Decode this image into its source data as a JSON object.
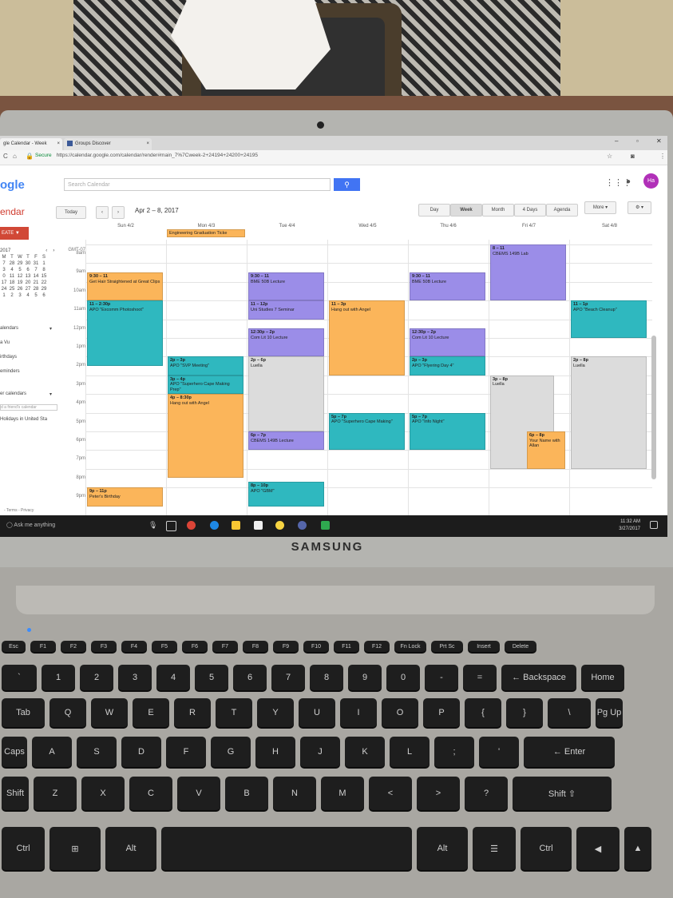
{
  "browser": {
    "tabs": [
      {
        "label": "gle Calendar - Week"
      },
      {
        "label": "Groups Discover"
      }
    ],
    "secure_label": "Secure",
    "url": "https://calendar.google.com/calendar/render#main_7%7Cweek-2+24194+24200+24195"
  },
  "gcal": {
    "logo": "ogle",
    "app_name": "endar",
    "search_placeholder": "Search Calendar",
    "avatar_initials": "Ha",
    "today_label": "Today",
    "date_range": "Apr 2 – 8, 2017",
    "views": [
      "Day",
      "Week",
      "Month",
      "4 Days",
      "Agenda"
    ],
    "more_label": "More ▾",
    "create_label": "EATE ▼",
    "timezone": "GMT-07"
  },
  "mini_calendar": {
    "month_label": "2017",
    "weekdays": [
      "M",
      "T",
      "W",
      "T",
      "F",
      "S"
    ],
    "rows": [
      [
        "7",
        "28",
        "29",
        "30",
        "31",
        "1"
      ],
      [
        "3",
        "4",
        "5",
        "6",
        "7",
        "8"
      ],
      [
        "0",
        "11",
        "12",
        "13",
        "14",
        "15"
      ],
      [
        "17",
        "18",
        "19",
        "20",
        "21",
        "22"
      ],
      [
        "24",
        "25",
        "26",
        "27",
        "28",
        "29"
      ],
      [
        "1",
        "2",
        "3",
        "4",
        "5",
        "6"
      ]
    ]
  },
  "sidebar": {
    "my_calendars": "alendars",
    "items": [
      "a Vu",
      "irthdays",
      "eminders"
    ],
    "other_calendars": "er calendars",
    "add_friend": "d a friend's calendar",
    "holidays": "Holidays in United Sta",
    "links": "- Terms - Privacy"
  },
  "week": {
    "days": [
      "Sun 4/2",
      "Mon 4/3",
      "Tue 4/4",
      "Wed 4/5",
      "Thu 4/6",
      "Fri 4/7",
      "Sat 4/8"
    ],
    "hours": [
      "8am",
      "9am",
      "10am",
      "11am",
      "12pm",
      "1pm",
      "2pm",
      "3pm",
      "4pm",
      "5pm",
      "6pm",
      "7pm",
      "8pm",
      "9pm"
    ],
    "all_day": [
      {
        "day": 1,
        "title": "Engineering Graduation Ticke"
      }
    ],
    "events": [
      {
        "day": 0,
        "start": 9.5,
        "end": 11,
        "time": "9:30 – 11",
        "title": "Get Hair Straightened at Great Clips",
        "color": "orange"
      },
      {
        "day": 0,
        "start": 11,
        "end": 14.5,
        "time": "11 – 2:30p",
        "title": "APO \"Excomm Photoshoot\"",
        "color": "teal"
      },
      {
        "day": 0,
        "start": 21,
        "end": 22,
        "time": "9p – 11p",
        "title": "Peter's Birthday",
        "color": "orange"
      },
      {
        "day": 1,
        "start": 14,
        "end": 15,
        "time": "2p – 3p",
        "title": "APO \"SVP Meeting\"",
        "color": "teal"
      },
      {
        "day": 1,
        "start": 15,
        "end": 16,
        "time": "3p – 4p",
        "title": "APO \"Superhero Cape Making Prep\"",
        "color": "teal"
      },
      {
        "day": 1,
        "start": 16,
        "end": 20.5,
        "time": "4p – 8:30p",
        "title": "Hang out with Angel",
        "color": "orange"
      },
      {
        "day": 2,
        "start": 9.5,
        "end": 11,
        "time": "9:30 – 11",
        "title": "BME 50B Lecture",
        "color": "purple"
      },
      {
        "day": 2,
        "start": 11,
        "end": 12,
        "time": "11 – 12p",
        "title": "Uni Studies 7 Seminar",
        "color": "purple"
      },
      {
        "day": 2,
        "start": 12.5,
        "end": 14,
        "time": "12:30p – 2p",
        "title": "Com Lit 10 Lecture",
        "color": "purple"
      },
      {
        "day": 2,
        "start": 14,
        "end": 18,
        "time": "2p – 6p",
        "title": "Luella",
        "color": "grey"
      },
      {
        "day": 2,
        "start": 18,
        "end": 19,
        "time": "6p – 7p",
        "title": "CBEMS 149B Lecture",
        "color": "purple"
      },
      {
        "day": 2,
        "start": 20.7,
        "end": 22,
        "time": "8p – 10p",
        "title": "APO \"GBM\"",
        "color": "teal"
      },
      {
        "day": 3,
        "start": 11,
        "end": 15,
        "time": "11 – 3p",
        "title": "Hang out with Angel",
        "color": "orange"
      },
      {
        "day": 3,
        "start": 17,
        "end": 19,
        "time": "5p – 7p",
        "title": "APO \"Superhero Cape Making\"",
        "color": "teal"
      },
      {
        "day": 4,
        "start": 9.5,
        "end": 11,
        "time": "9:30 – 11",
        "title": "BME 50B Lecture",
        "color": "purple"
      },
      {
        "day": 4,
        "start": 12.5,
        "end": 14,
        "time": "12:30p – 2p",
        "title": "Com Lit 10 Lecture",
        "color": "purple"
      },
      {
        "day": 4,
        "start": 14,
        "end": 15,
        "time": "2p – 3p",
        "title": "APO \"Flyering Day 4\"",
        "color": "teal"
      },
      {
        "day": 4,
        "start": 17,
        "end": 19,
        "time": "5p – 7p",
        "title": "APO \"Info Night\"",
        "color": "teal"
      },
      {
        "day": 5,
        "start": 8,
        "end": 11,
        "time": "8 – 11",
        "title": "CBEMS 149B Lab",
        "color": "purple"
      },
      {
        "day": 5,
        "start": 15,
        "end": 20,
        "time": "3p – 8p",
        "title": "Luella",
        "color": "grey"
      },
      {
        "day": 5,
        "start": 18,
        "end": 20,
        "time": "6p – 8p",
        "title": "Your Name with Allan",
        "color": "orange"
      },
      {
        "day": 6,
        "start": 11,
        "end": 13,
        "time": "11 – 1p",
        "title": "APO \"Beach Cleanup\"",
        "color": "teal"
      },
      {
        "day": 6,
        "start": 14,
        "end": 20,
        "time": "2p – 8p",
        "title": "Luella",
        "color": "grey"
      }
    ]
  },
  "taskbar": {
    "search_text": "Ask me anything",
    "time": "11:32 AM",
    "date": "3/27/2017"
  },
  "laptop": {
    "brand": "SAMSUNG"
  },
  "keyboard": {
    "rows": [
      [
        "Esc",
        "F1",
        "F2",
        "F3",
        "F4",
        "F5",
        "F6",
        "F7",
        "F8",
        "F9",
        "F10",
        "F11",
        "F12",
        "Fn Lock",
        "Prt Sc",
        "Insert",
        "Delete"
      ],
      [
        "`",
        "1",
        "2",
        "3",
        "4",
        "5",
        "6",
        "7",
        "8",
        "9",
        "0",
        "-",
        "=",
        "← Backspace",
        "Home"
      ],
      [
        "Tab",
        "Q",
        "W",
        "E",
        "R",
        "T",
        "Y",
        "U",
        "I",
        "O",
        "P",
        "{",
        "}",
        "\\",
        "Pg Up"
      ],
      [
        "Caps",
        "A",
        "S",
        "D",
        "F",
        "G",
        "H",
        "J",
        "K",
        "L",
        ";",
        "'",
        "← Enter"
      ],
      [
        "Shift",
        "Z",
        "X",
        "C",
        "V",
        "B",
        "N",
        "M",
        "<",
        ">",
        "?",
        "Shift ⇧"
      ],
      [
        "Ctrl",
        "⊞",
        "Alt",
        "",
        "Alt",
        "☰",
        "Ctrl",
        "◀",
        "▲"
      ]
    ]
  },
  "colors": {
    "orange": "#fbb55a",
    "purple": "#9b8de8",
    "teal": "#2fb8bf",
    "grey": "#dcdcdc",
    "create_red": "#d14836",
    "search_blue": "#4174f3",
    "avatar": "#b130b8"
  }
}
